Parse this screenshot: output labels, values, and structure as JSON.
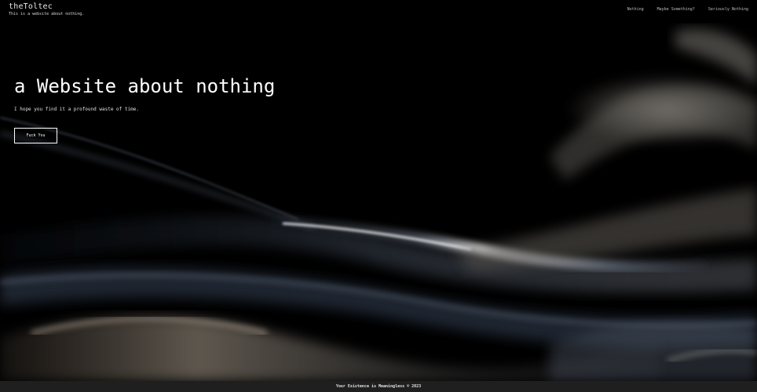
{
  "brand": {
    "title": "theToltec",
    "subtitle": "This is a website about nothing."
  },
  "nav": {
    "items": [
      {
        "label": "Nothing"
      },
      {
        "label": "Maybe Something?"
      },
      {
        "label": "Seriously Nothing"
      }
    ]
  },
  "hero": {
    "title": "a Website about nothing",
    "subtitle": "I hope you find it a profound waste of time.",
    "button_label": "Fuck You"
  },
  "footer": {
    "text": "Your Existence is Meaningless © 2023"
  },
  "colors": {
    "background": "#000000",
    "text": "#ffffff",
    "footer_bg": "#1f1f1f"
  }
}
